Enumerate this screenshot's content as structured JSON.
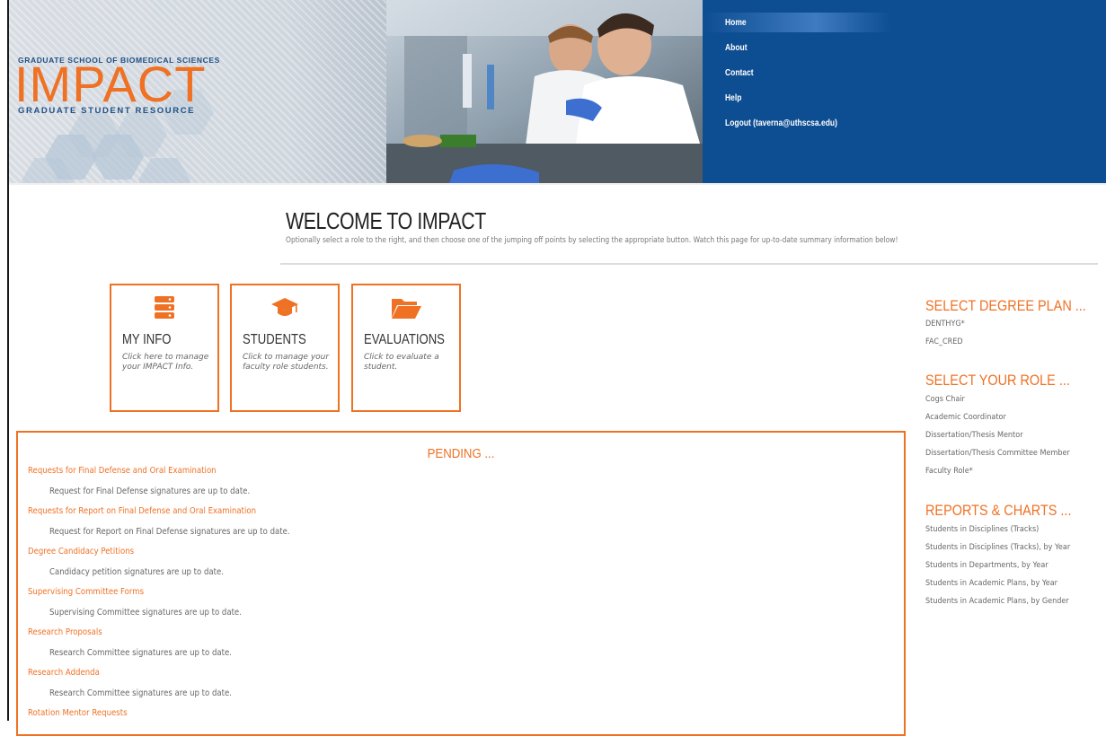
{
  "header": {
    "logo_top": "GRADUATE SCHOOL OF BIOMEDICAL SCIENCES",
    "logo_main": "IMPACT",
    "logo_sub": "GRADUATE STUDENT RESOURCE"
  },
  "nav": {
    "items": [
      {
        "label": "Home"
      },
      {
        "label": "About"
      },
      {
        "label": "Contact"
      },
      {
        "label": "Help"
      },
      {
        "label": "Logout (taverna@uthscsa.edu)"
      }
    ],
    "active": "Home"
  },
  "welcome": {
    "title": "WELCOME TO IMPACT",
    "subtitle": "Optionally select a role to the right, and then choose one of the jumping off points by selecting the appropriate button. Watch this page for up-to-date summary information below!"
  },
  "tiles": [
    {
      "icon": "server-icon",
      "title": "MY INFO",
      "desc": "Click here to manage your IMPACT Info."
    },
    {
      "icon": "graduation-cap-icon",
      "title": "STUDENTS",
      "desc": "Click to manage your faculty role students."
    },
    {
      "icon": "folder-open-icon",
      "title": "EVALUATIONS",
      "desc": "Click to evaluate a student."
    }
  ],
  "pending": {
    "title": "PENDING ...",
    "items": [
      {
        "link": "Requests for Final Defense and Oral Examination",
        "status": "Request for Final Defense signatures are up to date."
      },
      {
        "link": "Requests for Report on Final Defense and Oral Examination",
        "status": "Request for Report on Final Defense signatures are up to date."
      },
      {
        "link": "Degree Candidacy Petitions",
        "status": "Candidacy petition signatures are up to date."
      },
      {
        "link": "Supervising Committee Forms",
        "status": "Supervising Committee signatures are up to date."
      },
      {
        "link": "Research Proposals",
        "status": "Research Committee signatures are up to date."
      },
      {
        "link": "Research Addenda",
        "status": "Research Committee signatures are up to date."
      },
      {
        "link": "Rotation Mentor Requests",
        "status": ""
      }
    ]
  },
  "sidebar": {
    "degree_plan": {
      "heading": "SELECT DEGREE PLAN ...",
      "items": [
        "DENTHYG*",
        "FAC_CRED"
      ]
    },
    "role": {
      "heading": "SELECT YOUR ROLE ...",
      "items": [
        "Cogs Chair",
        "Academic Coordinator",
        "Dissertation/Thesis Mentor",
        "Dissertation/Thesis Committee Member",
        "Faculty Role*"
      ]
    },
    "reports": {
      "heading": "REPORTS & CHARTS ...",
      "items": [
        "Students in Disciplines (Tracks)",
        "Students in Disciplines (Tracks), by Year",
        "Students in Departments, by Year",
        "Students in Academic Plans, by Year",
        "Students in Academic Plans, by Gender"
      ]
    }
  },
  "colors": {
    "accent": "#ef7124",
    "nav_bg": "#0d4d91",
    "logo_blue": "#1f4f86"
  }
}
